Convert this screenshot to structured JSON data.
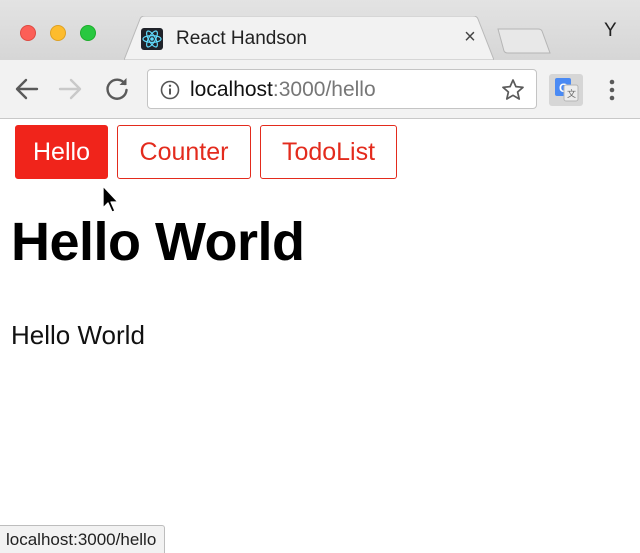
{
  "browser": {
    "tab": {
      "title": "React Handson",
      "close_glyph": "×",
      "favicon": "react-icon"
    },
    "profile_initial": "Y",
    "address_bar": {
      "host": "localhost",
      "rest": ":3000/hello"
    },
    "icons": {
      "back": "back-arrow-icon",
      "forward": "forward-arrow-icon",
      "reload": "reload-icon",
      "info": "info-icon",
      "bookmark": "star-icon",
      "extension": "google-translate-icon",
      "menu": "menu-dots-icon"
    },
    "status_url": "localhost:3000/hello"
  },
  "page": {
    "nav": [
      {
        "label": "Hello",
        "active": true
      },
      {
        "label": "Counter",
        "active": false
      },
      {
        "label": "TodoList",
        "active": false
      }
    ],
    "heading": "Hello World",
    "text": "Hello World"
  },
  "colors": {
    "accent": "#f0241b",
    "accent_border": "#e32b1d"
  }
}
